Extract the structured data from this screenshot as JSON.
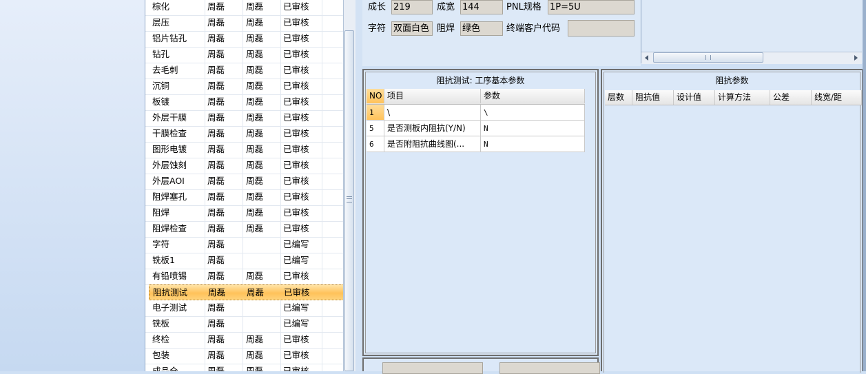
{
  "process_list": {
    "rows": [
      {
        "name": "棕化",
        "maker": "周磊",
        "checker": "周磊",
        "status": "已审核"
      },
      {
        "name": "层压",
        "maker": "周磊",
        "checker": "周磊",
        "status": "已审核"
      },
      {
        "name": "铝片钻孔",
        "maker": "周磊",
        "checker": "周磊",
        "status": "已审核"
      },
      {
        "name": "钻孔",
        "maker": "周磊",
        "checker": "周磊",
        "status": "已审核"
      },
      {
        "name": "去毛刺",
        "maker": "周磊",
        "checker": "周磊",
        "status": "已审核"
      },
      {
        "name": "沉铜",
        "maker": "周磊",
        "checker": "周磊",
        "status": "已审核"
      },
      {
        "name": "板镀",
        "maker": "周磊",
        "checker": "周磊",
        "status": "已审核"
      },
      {
        "name": "外层干膜",
        "maker": "周磊",
        "checker": "周磊",
        "status": "已审核"
      },
      {
        "name": "干膜检查",
        "maker": "周磊",
        "checker": "周磊",
        "status": "已审核"
      },
      {
        "name": "图形电镀",
        "maker": "周磊",
        "checker": "周磊",
        "status": "已审核"
      },
      {
        "name": "外层蚀刻",
        "maker": "周磊",
        "checker": "周磊",
        "status": "已审核"
      },
      {
        "name": "外层AOI",
        "maker": "周磊",
        "checker": "周磊",
        "status": "已审核"
      },
      {
        "name": "阻焊塞孔",
        "maker": "周磊",
        "checker": "周磊",
        "status": "已审核"
      },
      {
        "name": "阻焊",
        "maker": "周磊",
        "checker": "周磊",
        "status": "已审核"
      },
      {
        "name": "阻焊检查",
        "maker": "周磊",
        "checker": "周磊",
        "status": "已审核"
      },
      {
        "name": "字符",
        "maker": "周磊",
        "checker": "",
        "status": "已编写"
      },
      {
        "name": "铣板1",
        "maker": "周磊",
        "checker": "",
        "status": "已编写"
      },
      {
        "name": "有铅喷锡",
        "maker": "周磊",
        "checker": "周磊",
        "status": "已审核"
      },
      {
        "name": "阻抗测试",
        "maker": "周磊",
        "checker": "周磊",
        "status": "已审核",
        "selected": true
      },
      {
        "name": "电子测试",
        "maker": "周磊",
        "checker": "",
        "status": "已编写"
      },
      {
        "name": "铣板",
        "maker": "周磊",
        "checker": "",
        "status": "已编写"
      },
      {
        "name": "终检",
        "maker": "周磊",
        "checker": "周磊",
        "status": "已审核"
      },
      {
        "name": "包装",
        "maker": "周磊",
        "checker": "周磊",
        "status": "已审核"
      },
      {
        "name": "成品仓",
        "maker": "周磊",
        "checker": "周磊",
        "status": "已审核"
      }
    ]
  },
  "form": {
    "length_label": "成长",
    "length_value": "219",
    "width_label": "成宽",
    "width_value": "144",
    "pnl_label": "PNL规格",
    "pnl_value": "1P=5U",
    "char_label": "字符",
    "char_value": "双面白色",
    "mask_label": "阻焊",
    "mask_value": "绿色",
    "customer_label": "终端客户代码",
    "customer_value": ""
  },
  "process_params": {
    "title": "阻抗测试: 工序基本参数",
    "headers": [
      "NO",
      "项目",
      "参数"
    ],
    "rows": [
      {
        "no": "1",
        "item": "\\",
        "value": "\\"
      },
      {
        "no": "5",
        "item": "是否测板内阻抗(Y/N)",
        "value": "N"
      },
      {
        "no": "6",
        "item": "是否附阻抗曲线图(...",
        "value": "N"
      }
    ]
  },
  "impedance_params": {
    "title": "阻抗参数",
    "headers": [
      "层数",
      "阻抗值",
      "设计值",
      "计算方法",
      "公差",
      "线宽/距"
    ]
  },
  "colors": {
    "selection": "#ffc25a",
    "panel_bg": "#dbe8f8"
  }
}
